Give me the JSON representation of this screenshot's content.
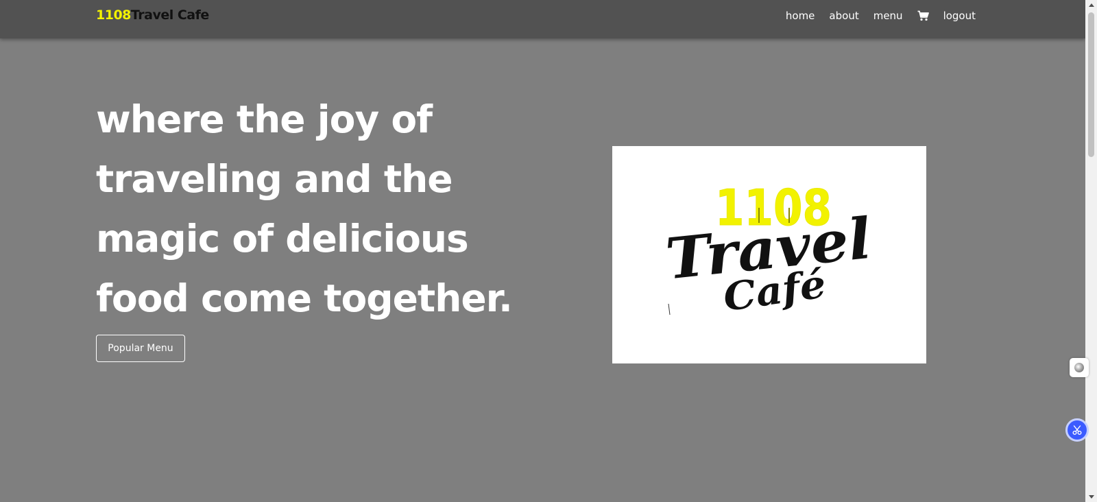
{
  "navbar": {
    "brand_number": "1108",
    "brand_name": "Travel Cafe",
    "links": {
      "home": "home",
      "about": "about",
      "menu": "menu",
      "logout": "logout"
    },
    "cart_icon": "cart-icon"
  },
  "hero": {
    "title": "where the joy of traveling and the magic of delicious food come together.",
    "button_label": "Popular Menu"
  },
  "logo": {
    "number": "1108",
    "word1": "Travel",
    "word2": "Café"
  },
  "colors": {
    "page_background": "#7f7f7f",
    "navbar_background": "#525252",
    "brand_accent": "#f2f200",
    "brand_dark": "#111111",
    "text_light": "#ffffff",
    "widget_blue": "#3b5bff"
  },
  "widgets": {
    "extension_icon": "extension-icon",
    "scissors_icon": "scissors-icon"
  }
}
